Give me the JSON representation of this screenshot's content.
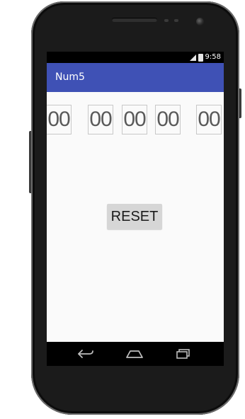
{
  "status_bar": {
    "time": "9:58",
    "icons": [
      "signal-icon",
      "battery-icon"
    ]
  },
  "app": {
    "title": "Num5",
    "accent_color": "#3f51b5"
  },
  "digits": [
    "00",
    "00",
    "00",
    "00",
    "00"
  ],
  "reset_button": {
    "label": "RESET"
  },
  "nav_bar": {
    "icons": [
      "back-icon",
      "home-icon",
      "recents-icon"
    ]
  }
}
